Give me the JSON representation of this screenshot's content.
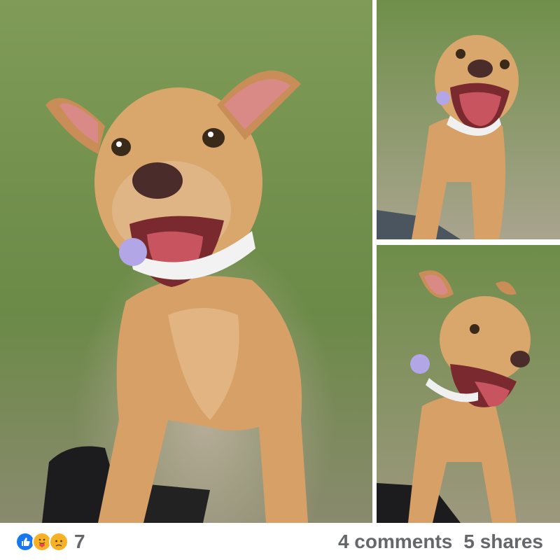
{
  "post": {
    "photos": [
      {
        "name": "photo-main",
        "alt": ""
      },
      {
        "name": "photo-top-right",
        "alt": ""
      },
      {
        "name": "photo-bottom-right",
        "alt": ""
      }
    ],
    "reactions": {
      "icons": [
        "like-icon",
        "care-icon",
        "sad-icon"
      ],
      "count": "7"
    },
    "comments_label": "4 comments",
    "shares_label": "5 shares"
  },
  "colors": {
    "like_blue": "#1877f2",
    "care_yellow": "#f7b125",
    "stat_gray": "#65676b",
    "grass": "#6f8f4a",
    "dog_coat": "#d9a66b"
  }
}
